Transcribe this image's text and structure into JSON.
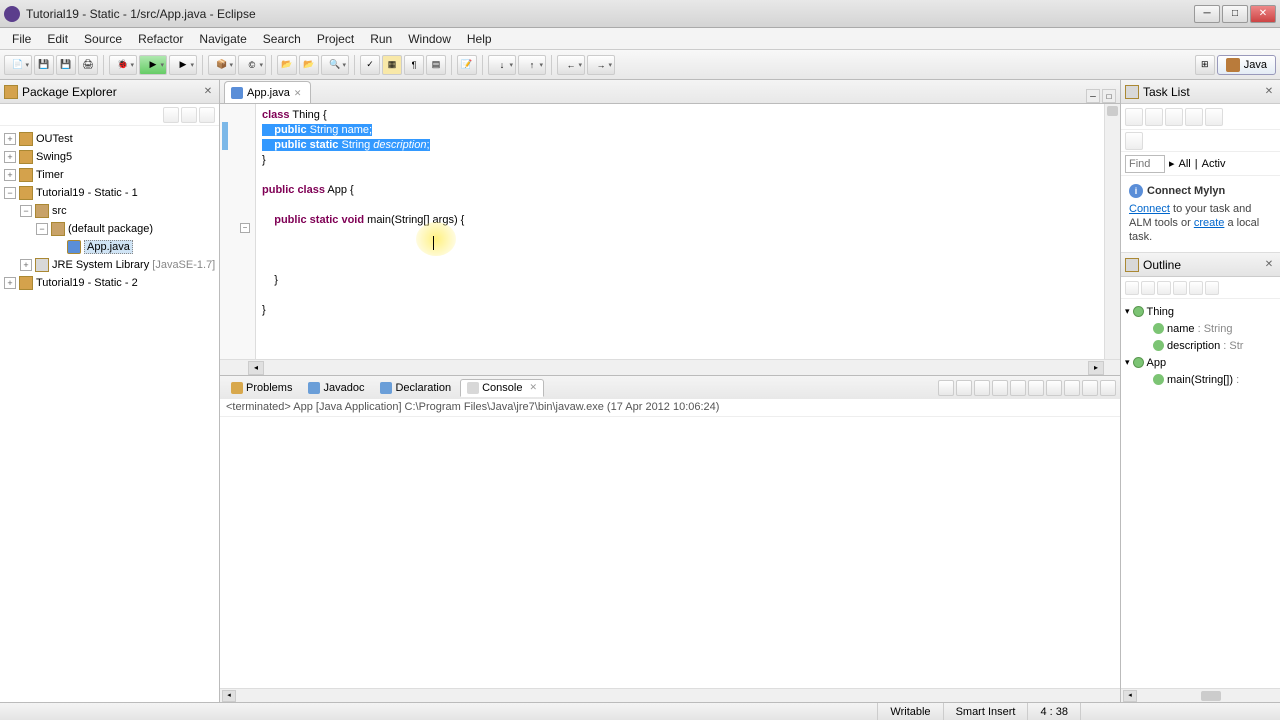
{
  "title": "Tutorial19 - Static - 1/src/App.java - Eclipse",
  "menu": [
    "File",
    "Edit",
    "Source",
    "Refactor",
    "Navigate",
    "Search",
    "Project",
    "Run",
    "Window",
    "Help"
  ],
  "perspective": "Java",
  "packageExplorer": {
    "title": "Package Explorer",
    "items": {
      "outest": "OUTest",
      "swing5": "Swing5",
      "timer": "Timer",
      "tut1": "Tutorial19 - Static - 1",
      "src": "src",
      "defpkg": "(default package)",
      "appjava": "App.java",
      "jre": "JRE System Library",
      "jrever": "[JavaSE-1.7]",
      "tut2": "Tutorial19 - Static - 2"
    }
  },
  "editor": {
    "tab": "App.java",
    "code": {
      "l1_pre": "class Thing {",
      "l2_sel": "    public String name;",
      "l3_sel": "    public static String description;",
      "l4": "}",
      "l5": "",
      "l6": "public class App {",
      "l7": "",
      "l8": "    public static void main(String[] args) {",
      "l9": "",
      "l10": "",
      "l11": "",
      "l12": "    }",
      "l13": "",
      "l14": "}"
    }
  },
  "bottomTabs": {
    "problems": "Problems",
    "javadoc": "Javadoc",
    "declaration": "Declaration",
    "console": "Console"
  },
  "consoleInfo": "<terminated> App [Java Application] C:\\Program Files\\Java\\jre7\\bin\\javaw.exe (17 Apr 2012 10:06:24)",
  "taskList": {
    "title": "Task List",
    "findPlaceholder": "Find",
    "all": "All",
    "activ": "Activ"
  },
  "mylyn": {
    "title": "Connect Mylyn",
    "text1": "Connect",
    "text2": " to your task and ALM tools or ",
    "text3": "create",
    "text4": " a local task."
  },
  "outline": {
    "title": "Outline",
    "thing": "Thing",
    "name": "name",
    "nameType": " : String",
    "desc": "description",
    "descType": " : Str",
    "app": "App",
    "main": "main(String[])",
    "mainType": " :"
  },
  "status": {
    "writable": "Writable",
    "insert": "Smart Insert",
    "pos": "4 : 38"
  }
}
